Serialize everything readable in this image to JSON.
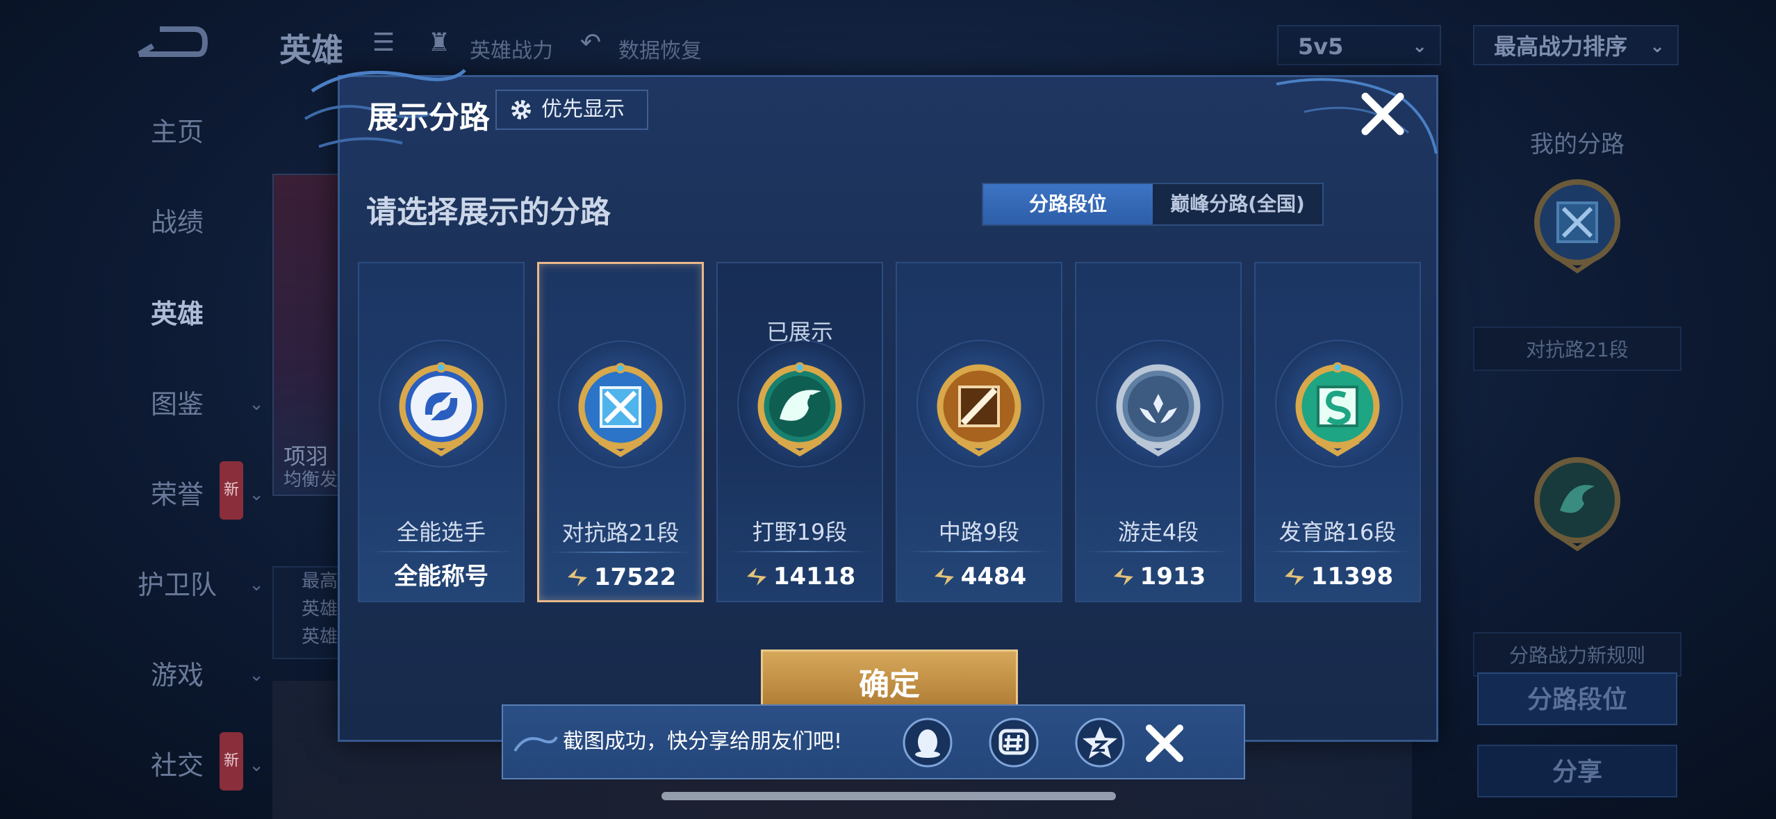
{
  "topbar": {
    "title": "英雄",
    "link_power": "英雄战力",
    "link_restore": "数据恢复",
    "mode_select": "5v5",
    "sort_select": "最高战力排序"
  },
  "side_nav": [
    {
      "label": "主页"
    },
    {
      "label": "战绩"
    },
    {
      "label": "英雄"
    },
    {
      "label": "图鉴"
    },
    {
      "label": "荣誉",
      "badge": "新"
    },
    {
      "label": "护卫队"
    },
    {
      "label": "游戏"
    },
    {
      "label": "社交",
      "badge": "新"
    }
  ],
  "hero_card": {
    "name": "项羽",
    "sub": "均衡发"
  },
  "hero_stats": [
    "最高",
    "英雄",
    "英雄"
  ],
  "right_panel": {
    "title": "我的分路",
    "lane_label": "对抗路21段",
    "rules_label": "分路战力新规则",
    "lane_button": "分路段位",
    "share_button": "分享"
  },
  "dialog": {
    "title": "展示分路",
    "priority_button": "优先显示",
    "prompt": "请选择展示的分路",
    "tabs": [
      "分路段位",
      "巅峰分路(全国)"
    ],
    "active_tab": 0,
    "confirm": "确定",
    "cards": [
      {
        "name": "全能选手",
        "value": "全能称号",
        "shown_note": "",
        "icon": "all-round-badge-icon",
        "color": "#3b6fd6"
      },
      {
        "name": "对抗路21段",
        "value": "17522",
        "shown_note": "",
        "icon": "clash-lane-badge-icon",
        "color": "#3aa5e6",
        "selected": true
      },
      {
        "name": "打野19段",
        "value": "14118",
        "shown_note": "已展示",
        "icon": "jungle-badge-icon",
        "color": "#1f9a86"
      },
      {
        "name": "中路9段",
        "value": "4484",
        "shown_note": "",
        "icon": "mid-lane-badge-icon",
        "color": "#c77a2a"
      },
      {
        "name": "游走4段",
        "value": "1913",
        "shown_note": "",
        "icon": "roam-badge-icon",
        "color": "#8aa8c8"
      },
      {
        "name": "发育路16段",
        "value": "11398",
        "shown_note": "",
        "icon": "farm-lane-badge-icon",
        "color": "#22b08c"
      }
    ]
  },
  "toast": {
    "text": "截图成功，快分享给朋友们吧!",
    "share_icons": [
      "qq-icon",
      "wechat-moments-icon",
      "qzone-icon"
    ]
  }
}
